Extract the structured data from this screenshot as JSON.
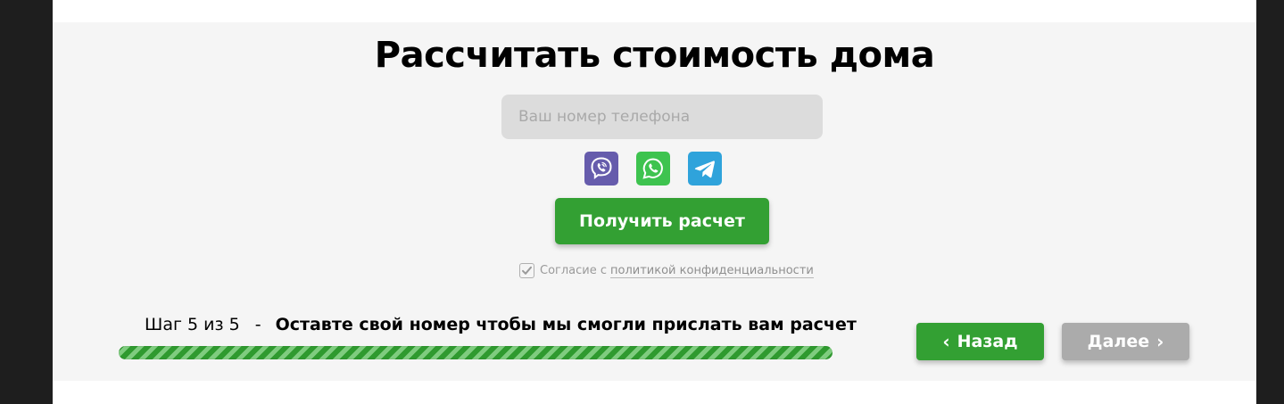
{
  "form": {
    "title": "Рассчитать стоимость дома",
    "phone_placeholder": "Ваш номер телефона",
    "phone_value": "",
    "messengers": [
      {
        "name": "Viber",
        "icon": "viber-icon",
        "color": "#665CAC"
      },
      {
        "name": "WhatsApp",
        "icon": "whatsapp-icon",
        "color": "#3EC34F"
      },
      {
        "name": "Telegram",
        "icon": "telegram-icon",
        "color": "#2FA3DB"
      }
    ],
    "submit_label": "Получить расчет",
    "consent_text": "Согласие с",
    "consent_link": "политикой конфиденциальности",
    "consent_checked": true
  },
  "steps": {
    "current_label": "Шаг 5 из 5",
    "separator": "-",
    "description": "Оставте свой номер чтобы мы смогли прислать вам расчет",
    "current": 5,
    "total": 5,
    "progress": 1.0
  },
  "nav": {
    "back_label": "Назад",
    "next_label": "Далее",
    "next_enabled": false
  },
  "colors": {
    "accent": "#33A033",
    "disabled": "#ABABAB",
    "panel_bg": "#F5F5F5"
  }
}
